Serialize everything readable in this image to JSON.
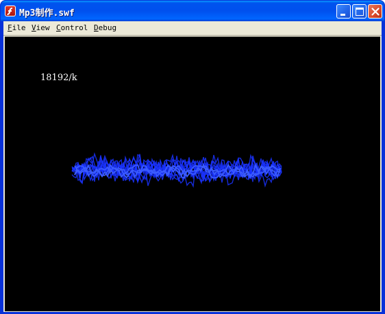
{
  "window": {
    "title": "Mp3制作.swf",
    "buttons": {
      "minimize": "minimize",
      "maximize": "maximize",
      "close": "close"
    }
  },
  "menubar": {
    "items": [
      {
        "label": "File",
        "accel": "F",
        "rest": "ile"
      },
      {
        "label": "View",
        "accel": "V",
        "rest": "iew"
      },
      {
        "label": "Control",
        "accel": "C",
        "rest": "ontrol"
      },
      {
        "label": "Debug",
        "accel": "D",
        "rest": "ebug"
      }
    ]
  },
  "stage": {
    "bitrate_text": "18192/k",
    "background": "#000000",
    "wave_color": "#1a33ff"
  },
  "icons": [
    "flash-player-icon",
    "minimize-icon",
    "maximize-icon",
    "close-icon"
  ]
}
